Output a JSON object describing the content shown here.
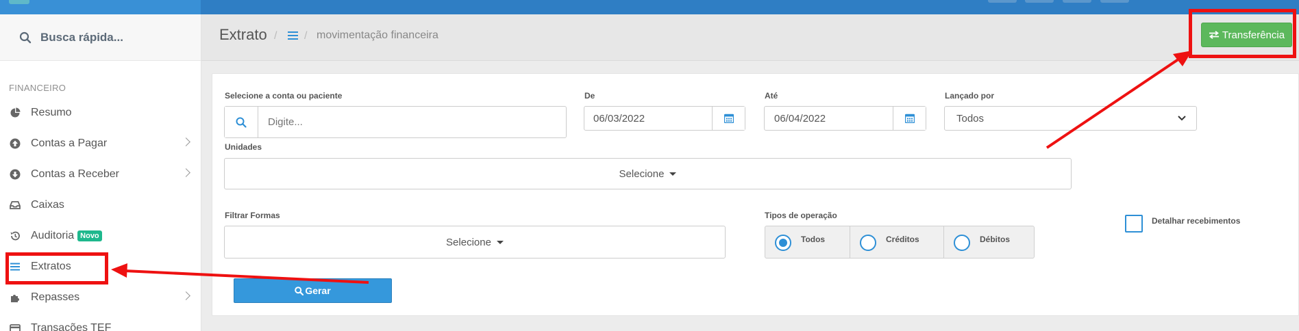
{
  "sidebar": {
    "search_label": "Busca rápida...",
    "section": "FINANCEIRO",
    "items": [
      {
        "label": "Resumo",
        "icon": "pie-chart-icon"
      },
      {
        "label": "Contas a Pagar",
        "icon": "arrow-up-circle-icon"
      },
      {
        "label": "Contas a Receber",
        "icon": "arrow-down-circle-icon"
      },
      {
        "label": "Caixas",
        "icon": "inbox-icon"
      },
      {
        "label": "Auditoria",
        "icon": "history-icon",
        "badge": "Novo"
      },
      {
        "label": "Extratos",
        "icon": "list-icon"
      },
      {
        "label": "Repasses",
        "icon": "puzzle-icon"
      },
      {
        "label": "Transações TEF",
        "icon": "credit-card-icon"
      }
    ]
  },
  "header": {
    "title": "Extrato",
    "sep": "/",
    "breadcrumb": "movimentação financeira",
    "transfer_label": "Transferência"
  },
  "form": {
    "account_label": "Selecione a conta ou paciente",
    "account_placeholder": "Digite...",
    "from_label": "De",
    "from_value": "06/03/2022",
    "to_label": "Até",
    "to_value": "06/04/2022",
    "posted_by_label": "Lançado por",
    "posted_by_value": "Todos",
    "units_label": "Unidades",
    "units_value": "Selecione",
    "forms_label": "Filtrar Formas",
    "forms_value": "Selecione",
    "op_types_label": "Tipos de operação",
    "op_types": [
      "Todos",
      "Créditos",
      "Débitos"
    ],
    "op_selected": "Todos",
    "detail_label": "Detalhar recebimentos",
    "generate_label": "Gerar"
  },
  "colors": {
    "highlight": "#ee1111",
    "primary": "#3598dc",
    "success": "#5cb85c",
    "topbar": "#2f7ec4"
  }
}
